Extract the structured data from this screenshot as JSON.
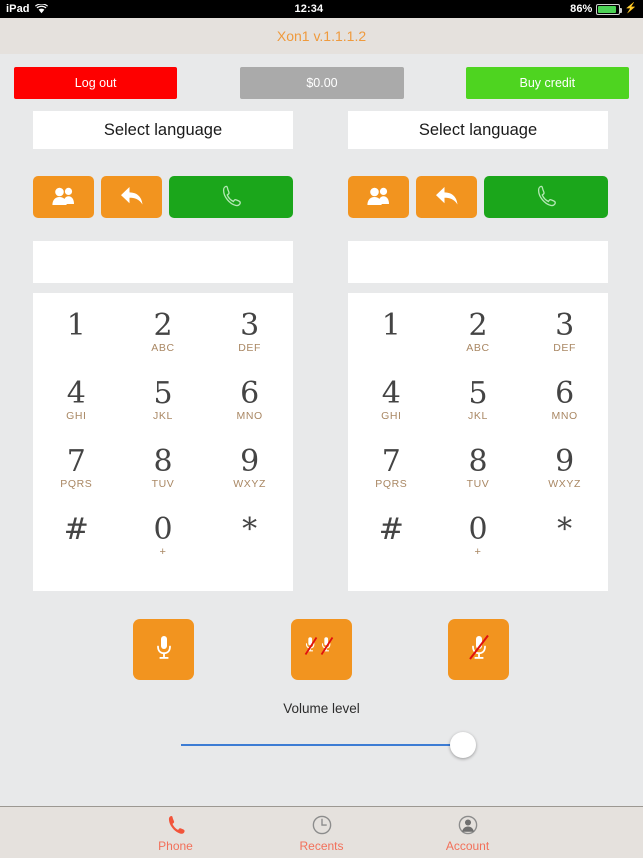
{
  "statusbar": {
    "device": "iPad",
    "wifi_icon": "wifi-icon",
    "time": "12:34",
    "battery_percent": "86%",
    "battery_icon": "battery-icon",
    "charging_icon": "charging-bolt-icon"
  },
  "header": {
    "title": "Xon1 v.1.1.1.2",
    "title_color": "#ef9a3d",
    "background": "#e5e1dd"
  },
  "toolbar": {
    "logout_label": "Log out",
    "logout_color": "#fe0000",
    "balance_label": "$0.00",
    "balance_color": "#aaaaaa",
    "buy_credit_label": "Buy credit",
    "buy_credit_color": "#4ed420"
  },
  "panels": [
    {
      "language_label": "Select language",
      "number_value": "",
      "number_placeholder": "",
      "contacts_icon": "contacts-icon",
      "back_icon": "back-arrow-icon",
      "call_icon": "phone-handset-icon",
      "call_color": "#1ba61b",
      "action_color": "#f2941f"
    },
    {
      "language_label": "Select language",
      "number_value": "",
      "number_placeholder": "",
      "contacts_icon": "contacts-icon",
      "back_icon": "back-arrow-icon",
      "call_icon": "phone-handset-icon",
      "call_color": "#1ba61b",
      "action_color": "#f2941f"
    }
  ],
  "keypad": [
    {
      "digit": "1",
      "sub": ""
    },
    {
      "digit": "2",
      "sub": "ABC"
    },
    {
      "digit": "3",
      "sub": "DEF"
    },
    {
      "digit": "4",
      "sub": "GHI"
    },
    {
      "digit": "5",
      "sub": "JKL"
    },
    {
      "digit": "6",
      "sub": "MNO"
    },
    {
      "digit": "7",
      "sub": "PQRS"
    },
    {
      "digit": "8",
      "sub": "TUV"
    },
    {
      "digit": "9",
      "sub": "WXYZ"
    },
    {
      "digit": "#",
      "sub": ""
    },
    {
      "digit": "0",
      "sub": "+"
    },
    {
      "digit": "*",
      "sub": ""
    }
  ],
  "mic_buttons": [
    {
      "icon": "microphone-icon",
      "state": "on"
    },
    {
      "icon": "microphone-double-muted-icon",
      "state": "muted-both"
    },
    {
      "icon": "microphone-muted-icon",
      "state": "muted"
    }
  ],
  "volume": {
    "label": "Volume level",
    "value": 100,
    "min": 0,
    "max": 100,
    "track_color": "#3c7cd4"
  },
  "tabbar": [
    {
      "label": "Phone",
      "icon": "phone-handset-icon",
      "active": true
    },
    {
      "label": "Recents",
      "icon": "clock-icon",
      "active": false
    },
    {
      "label": "Account",
      "icon": "person-icon",
      "active": false
    }
  ]
}
